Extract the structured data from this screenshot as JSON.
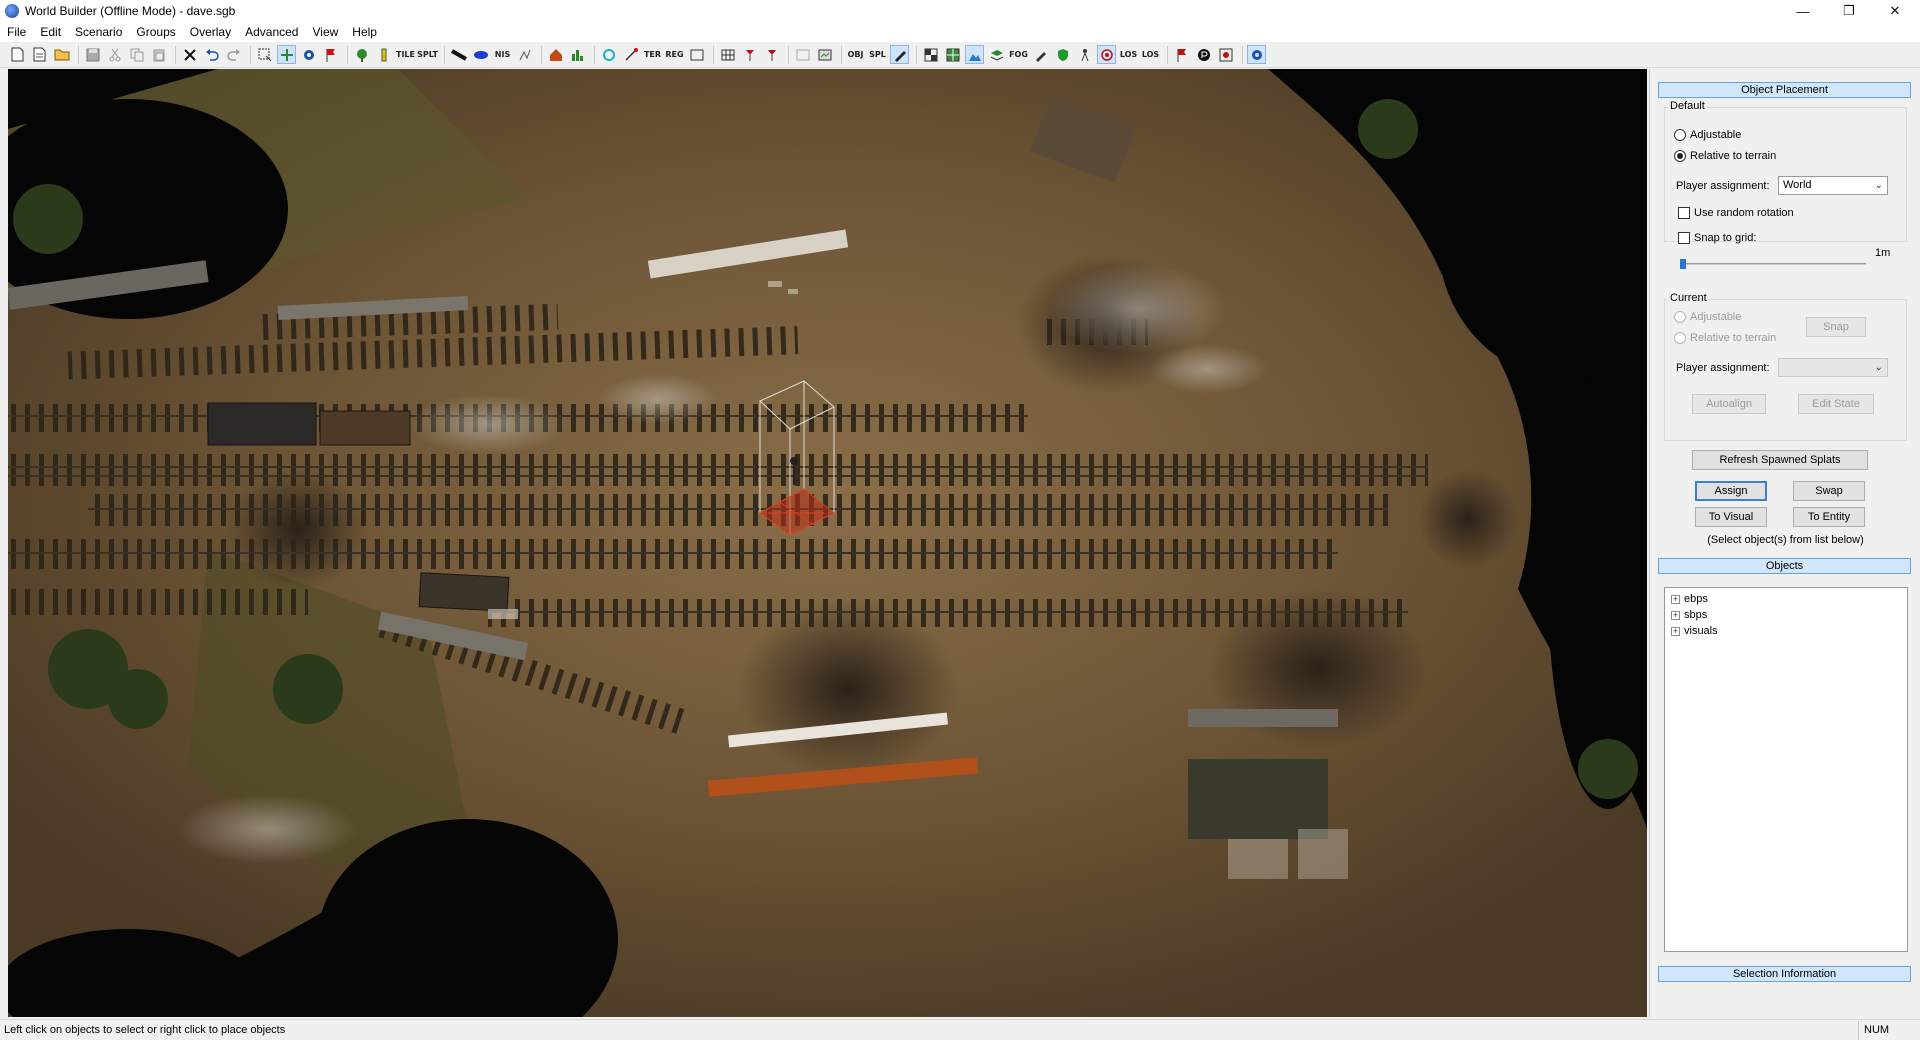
{
  "window": {
    "title": "World Builder (Offline Mode) - dave.sgb",
    "minimize_glyph": "—",
    "restore_glyph": "❐",
    "close_glyph": "✕"
  },
  "menu": [
    "File",
    "Edit",
    "Scenario",
    "Groups",
    "Overlay",
    "Advanced",
    "View",
    "Help"
  ],
  "toolbar": {
    "text_buttons": {
      "tile": "TILE",
      "split": "SPLT",
      "nis": "NIS",
      "ter": "TER",
      "reg": "REG",
      "obj": "OBJ",
      "spl": "SPL",
      "fog": "FOG",
      "los1": "LOS",
      "los2": "LOS"
    }
  },
  "panel": {
    "object_placement": {
      "header": "Object Placement",
      "default": {
        "title": "Default",
        "adjustable": "Adjustable",
        "relative": "Relative to terrain",
        "selected": "relative",
        "player_label": "Player assignment:",
        "player_value": "World",
        "random_rotation": "Use random rotation",
        "snap_grid": "Snap to grid:",
        "grid_value": "1m",
        "grid_slider_fraction": 0.0
      },
      "current": {
        "title": "Current",
        "adjustable": "Adjustable",
        "relative": "Relative to terrain",
        "snap_button": "Snap",
        "player_label": "Player assignment:",
        "player_value": "",
        "autoalign_button": "Autoalign",
        "edit_state_button": "Edit State"
      },
      "refresh_button": "Refresh Spawned Splats",
      "assign_button": "Assign",
      "swap_button": "Swap",
      "to_visual_button": "To Visual",
      "to_entity_button": "To Entity",
      "hint": "(Select object(s) from list below)"
    },
    "objects": {
      "header": "Objects",
      "items": [
        {
          "label": "ebps"
        },
        {
          "label": "sbps"
        },
        {
          "label": "visuals"
        }
      ]
    },
    "selection_info": {
      "header": "Selection Information"
    }
  },
  "status": {
    "message": "Left click on objects to select or right click to place objects",
    "num": "NUM"
  },
  "colors": {
    "accent": "#cfe6fb",
    "terrain": "#6e5638",
    "fog": "#050505"
  }
}
